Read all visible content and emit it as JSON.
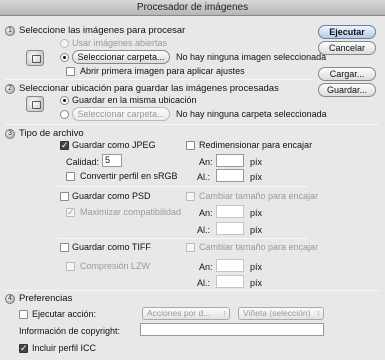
{
  "window": {
    "title": "Procesador de imágenes"
  },
  "buttons": {
    "run": "Ejecutar",
    "cancel": "Cancelar",
    "load": "Cargar...",
    "save": "Guardar..."
  },
  "source": {
    "number": "1",
    "heading": "Seleccione las imágenes para procesar",
    "use_open": "Usar imágenes abiertas",
    "select_folder": "Seleccionar carpeta...",
    "status": "No hay ninguna imagen seleccionada",
    "open_first": "Abrir primera imagen para aplicar ajustes"
  },
  "destination": {
    "number": "2",
    "heading": "Seleccionar ubicación para guardar las imágenes procesadas",
    "same_location": "Guardar en la misma ubicación",
    "select_folder": "Seleccionar carpeta...",
    "status": "No hay ninguna carpeta seleccionada"
  },
  "filetype": {
    "number": "3",
    "heading": "Tipo de archivo",
    "jpeg": {
      "label": "Guardar como JPEG",
      "resize": "Redimensionar para encajar",
      "quality_label": "Calidad:",
      "quality_value": "5",
      "srgb": "Convertir perfil en sRGB",
      "w_label": "An:",
      "h_label": "Al.:",
      "unit": "píx"
    },
    "psd": {
      "label": "Guardar como PSD",
      "resize": "Cambiar tamaño para encajar",
      "compat": "Maximizar compatibilidad",
      "w_label": "An:",
      "h_label": "Al.:",
      "unit": "píx"
    },
    "tiff": {
      "label": "Guardar como TIFF",
      "resize": "Cambiar tamaño para encajar",
      "lzw": "Compresión LZW",
      "w_label": "An:",
      "h_label": "Al.:",
      "unit": "píx"
    }
  },
  "prefs": {
    "number": "4",
    "heading": "Preferencias",
    "run_action": "Ejecutar acción:",
    "action_set": "Acciones por d...",
    "action": "Viñeta (selección)",
    "copyright_label": "Información de copyright:",
    "copyright_value": "",
    "icc": "Incluir perfil ICC"
  }
}
